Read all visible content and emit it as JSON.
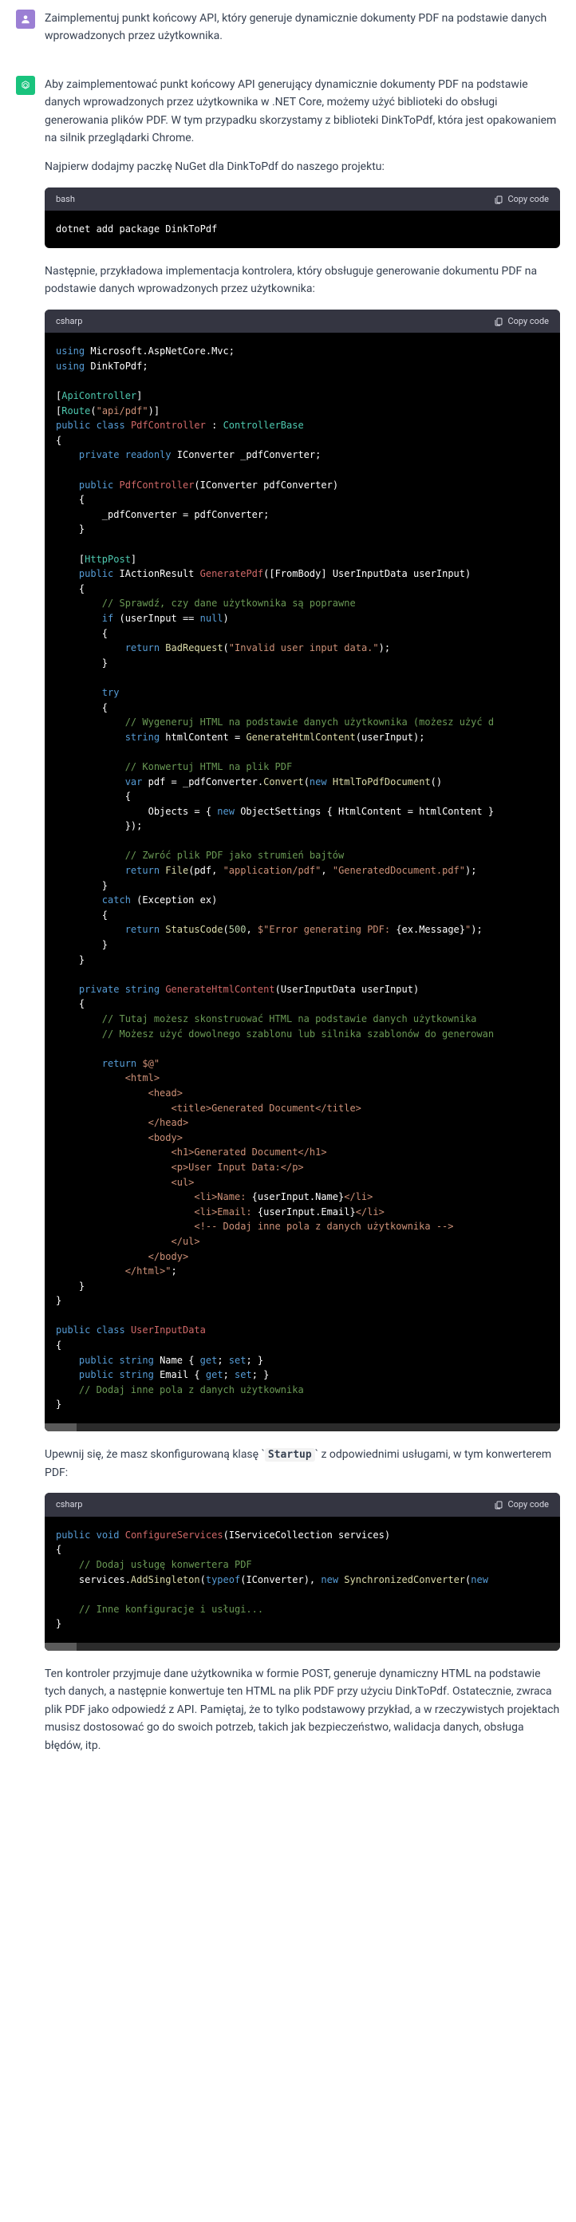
{
  "user_message": "Zaimplementuj punkt końcowy API, który generuje dynamicznie dokumenty PDF na podstawie danych wprowadzonych przez użytkownika.",
  "assistant": {
    "para1": "Aby zaimplementować punkt końcowy API generujący dynamicznie dokumenty PDF na podstawie danych wprowadzonych przez użytkownika w .NET Core, możemy użyć biblioteki do obsługi generowania plików PDF. W tym przypadku skorzystamy z biblioteki DinkToPdf, która jest opakowaniem na silnik przeglądarki Chrome.",
    "para2": "Najpierw dodajmy paczkę NuGet dla DinkToPdf do naszego projektu:",
    "para3": "Następnie, przykładowa implementacja kontrolera, który obsługuje generowanie dokumentu PDF na podstawie danych wprowadzonych przez użytkownika:",
    "para4_a": "Upewnij się, że masz skonfigurowaną klasę ",
    "para4_code": "Startup",
    "para4_b": " z odpowiednimi usługami, w tym konwerterem PDF:",
    "para5": "Ten kontroler przyjmuje dane użytkownika w formie POST, generuje dynamiczny HTML na podstawie tych danych, a następnie konwertuje ten HTML na plik PDF przy użyciu DinkToPdf. Ostatecznie, zwraca plik PDF jako odpowiedź z API. Pamiętaj, że to tylko podstawowy przykład, a w rzeczywistych projektach musisz dostosować go do swoich potrzeb, takich jak bezpieczeństwo, walidacja danych, obsługa błędów, itp."
  },
  "code1": {
    "lang": "bash",
    "copy": "Copy code",
    "line": "dotnet add package DinkToPdf"
  },
  "code2": {
    "lang": "csharp",
    "copy": "Copy code"
  },
  "code3": {
    "lang": "csharp",
    "copy": "Copy code"
  }
}
